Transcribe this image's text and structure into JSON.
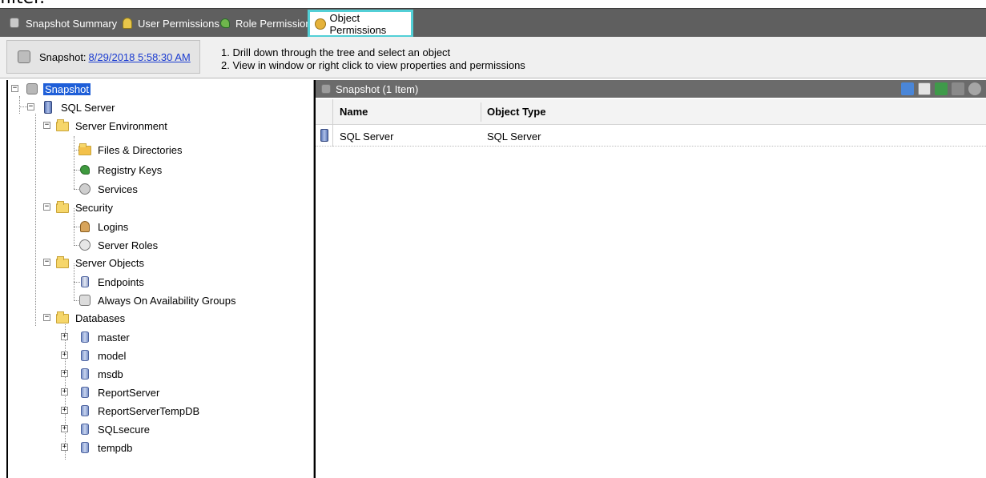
{
  "clipped_top_text": "filter.",
  "tabs": [
    {
      "label": "Snapshot Summary",
      "icon": "snapshot-icon",
      "active": false
    },
    {
      "label": "User Permissions",
      "icon": "users-icon",
      "active": false
    },
    {
      "label": "Role Permissions",
      "icon": "roles-icon",
      "active": false
    },
    {
      "label": "Object Permissions",
      "icon": "object-icon",
      "active": true
    }
  ],
  "infobar": {
    "snapshot_label": "Snapshot:",
    "snapshot_date": "8/29/2018 5:58:30 AM",
    "instruction_1": "1. Drill down through the tree and select an object",
    "instruction_2": "2. View in window or right click to view properties and permissions"
  },
  "tree": {
    "root": "Snapshot",
    "server": "SQL Server",
    "env": "Server Environment",
    "files": "Files & Directories",
    "registry": "Registry Keys",
    "services": "Services",
    "security": "Security",
    "logins": "Logins",
    "server_roles": "Server Roles",
    "server_objects": "Server Objects",
    "endpoints": "Endpoints",
    "ag": "Always On Availability Groups",
    "databases": "Databases",
    "dbs": [
      "master",
      "model",
      "msdb",
      "ReportServer",
      "ReportServerTempDB",
      "SQLsecure",
      "tempdb"
    ]
  },
  "grid": {
    "title": "Snapshot (1 Item)",
    "columns": [
      "Name",
      "Object Type"
    ],
    "rows": [
      {
        "name": "SQL Server",
        "type": "SQL Server"
      }
    ]
  }
}
